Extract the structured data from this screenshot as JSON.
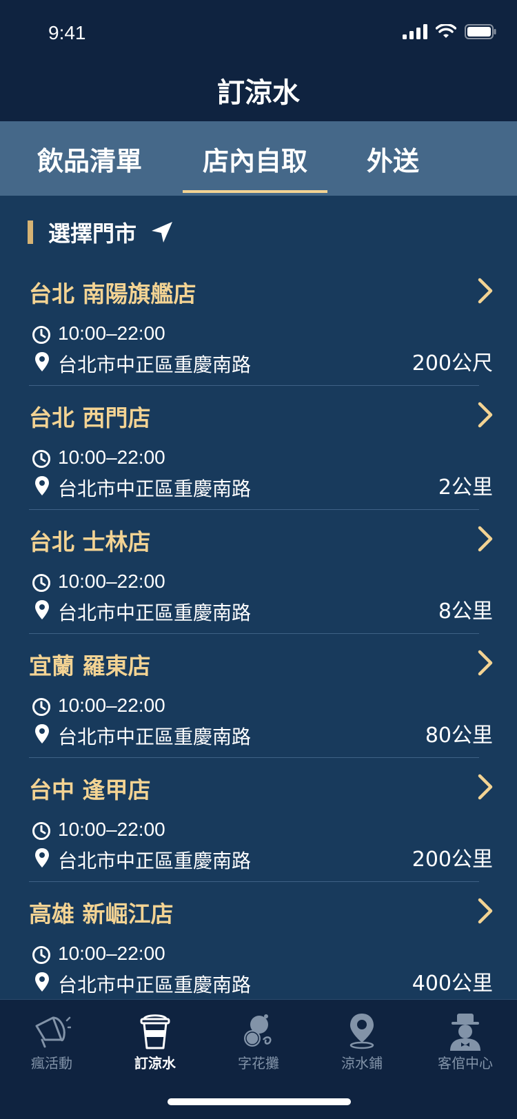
{
  "status": {
    "time": "9:41"
  },
  "nav": {
    "title": "訂涼水"
  },
  "tabs": [
    {
      "label": "飲品清單",
      "active": false
    },
    {
      "label": "店內自取",
      "active": true
    },
    {
      "label": "外送",
      "active": false
    }
  ],
  "section": {
    "title": "選擇門市",
    "icon": "location-arrow-icon"
  },
  "stores": [
    {
      "name": "台北 南陽旗艦店",
      "hours": "10:00–22:00",
      "address": "台北市中正區重慶南路",
      "distance": "200公尺"
    },
    {
      "name": "台北 西門店",
      "hours": "10:00–22:00",
      "address": "台北市中正區重慶南路",
      "distance": "2公里"
    },
    {
      "name": "台北 士林店",
      "hours": "10:00–22:00",
      "address": "台北市中正區重慶南路",
      "distance": "8公里"
    },
    {
      "name": "宜蘭 羅東店",
      "hours": "10:00–22:00",
      "address": "台北市中正區重慶南路",
      "distance": "80公里"
    },
    {
      "name": "台中 逢甲店",
      "hours": "10:00–22:00",
      "address": "台北市中正區重慶南路",
      "distance": "200公里"
    },
    {
      "name": "高雄 新崛江店",
      "hours": "10:00–22:00",
      "address": "台北市中正區重慶南路",
      "distance": "400公里"
    }
  ],
  "bottom_nav": [
    {
      "label": "瘋活動",
      "icon": "megaphone-icon",
      "active": false
    },
    {
      "label": "訂涼水",
      "icon": "cup-icon",
      "active": true
    },
    {
      "label": "字花攤",
      "icon": "flower-stall-icon",
      "active": false
    },
    {
      "label": "涼水鋪",
      "icon": "map-pin-icon",
      "active": false
    },
    {
      "label": "客倌中心",
      "icon": "gentleman-icon",
      "active": false
    }
  ],
  "colors": {
    "accent": "#f3d393",
    "header_bg": "#0f2340",
    "tab_bg": "#456889",
    "list_bg": "#183a5c"
  }
}
